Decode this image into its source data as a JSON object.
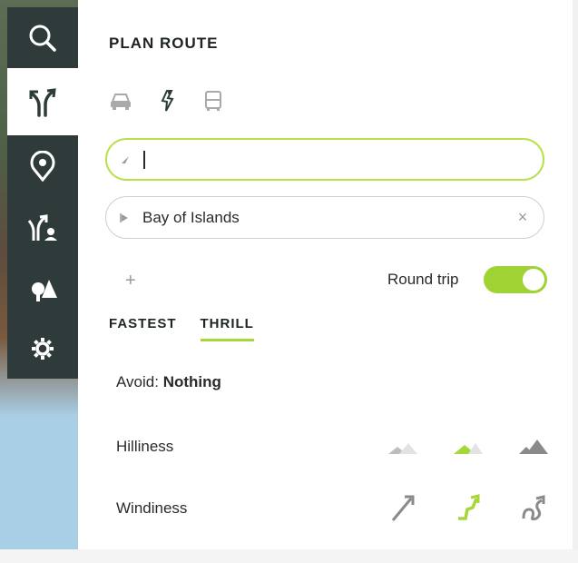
{
  "sidebar": {
    "items": [
      {
        "name": "search",
        "icon": "search-icon"
      },
      {
        "name": "plan-route",
        "icon": "route-icon",
        "active": true
      },
      {
        "name": "places",
        "icon": "location-pin-icon"
      },
      {
        "name": "my-routes",
        "icon": "user-route-icon"
      },
      {
        "name": "map-style",
        "icon": "map-layers-icon"
      },
      {
        "name": "settings",
        "icon": "gear-icon"
      }
    ]
  },
  "panel": {
    "title": "PLAN ROUTE",
    "modes": [
      {
        "name": "car",
        "icon": "car-icon"
      },
      {
        "name": "motorcycle",
        "icon": "motorcycle-icon",
        "active": true
      },
      {
        "name": "bus",
        "icon": "bus-icon"
      }
    ],
    "start": {
      "value": "",
      "placeholder": "",
      "icon": "arrow-icon"
    },
    "destination": {
      "value": "Bay of Islands",
      "icon": "flag-icon",
      "clear": "×"
    },
    "add": "+",
    "round_trip": {
      "label": "Round trip",
      "on": true
    },
    "tabs": [
      {
        "label": "FASTEST",
        "active": false
      },
      {
        "label": "THRILL",
        "active": true
      }
    ],
    "avoid": {
      "label": "Avoid:",
      "value": "Nothing"
    },
    "hilliness": {
      "label": "Hilliness",
      "selected": 1
    },
    "windiness": {
      "label": "Windiness",
      "selected": 1
    }
  },
  "colors": {
    "accent": "#a5d63a",
    "sidebar": "#2f3b3a",
    "inactive_icon": "#9a9a9a"
  }
}
